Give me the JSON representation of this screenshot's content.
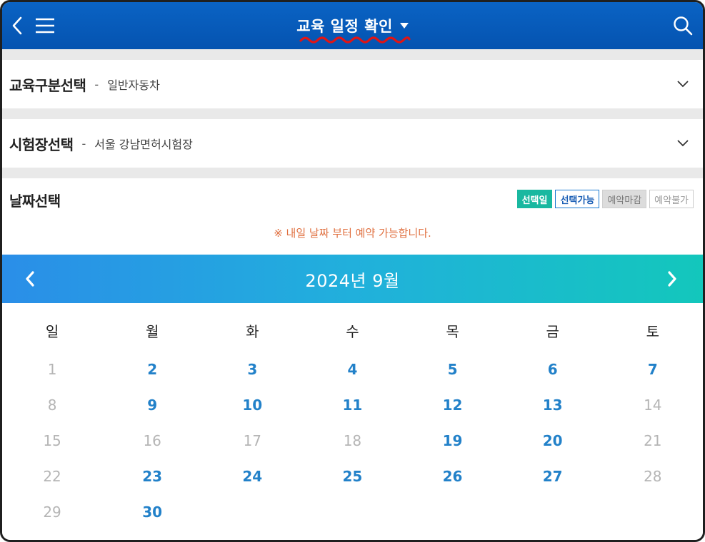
{
  "header": {
    "title": "교육 일정 확인",
    "bg_color": "#0553b0",
    "icons": {
      "back": "chevron-left-icon",
      "menu": "hamburger-menu-icon",
      "search": "search-icon",
      "dropdown": "caret-down-icon"
    }
  },
  "selectors": {
    "education_type": {
      "label": "교육구분선택",
      "separator": "-",
      "value": "일반자동차"
    },
    "test_center": {
      "label": "시험장선택",
      "separator": "-",
      "value": "서울 강남면허시험장"
    }
  },
  "date_panel": {
    "title": "날짜선택",
    "legend": {
      "selected": "선택일",
      "available": "선택가능",
      "closed": "예약마감",
      "unavailable": "예약불가"
    },
    "notice": "※ 내일 날짜 부터 예약 가능합니다.",
    "colors": {
      "selected": "#19b8a0",
      "available": "#2281c9",
      "unavailable": "#b5b5b5",
      "notice": "#e07040"
    }
  },
  "calendar": {
    "month_label": "2024년  9월",
    "weekdays": [
      "일",
      "월",
      "화",
      "수",
      "목",
      "금",
      "토"
    ],
    "weeks": [
      [
        {
          "d": "1",
          "av": false
        },
        {
          "d": "2",
          "av": true
        },
        {
          "d": "3",
          "av": true
        },
        {
          "d": "4",
          "av": true
        },
        {
          "d": "5",
          "av": true
        },
        {
          "d": "6",
          "av": true
        },
        {
          "d": "7",
          "av": true
        }
      ],
      [
        {
          "d": "8",
          "av": false
        },
        {
          "d": "9",
          "av": true
        },
        {
          "d": "10",
          "av": true
        },
        {
          "d": "11",
          "av": true
        },
        {
          "d": "12",
          "av": true
        },
        {
          "d": "13",
          "av": true
        },
        {
          "d": "14",
          "av": false
        }
      ],
      [
        {
          "d": "15",
          "av": false
        },
        {
          "d": "16",
          "av": false
        },
        {
          "d": "17",
          "av": false
        },
        {
          "d": "18",
          "av": false
        },
        {
          "d": "19",
          "av": true
        },
        {
          "d": "20",
          "av": true
        },
        {
          "d": "21",
          "av": false
        }
      ],
      [
        {
          "d": "22",
          "av": false
        },
        {
          "d": "23",
          "av": true
        },
        {
          "d": "24",
          "av": true
        },
        {
          "d": "25",
          "av": true
        },
        {
          "d": "26",
          "av": true
        },
        {
          "d": "27",
          "av": true
        },
        {
          "d": "28",
          "av": false
        }
      ],
      [
        {
          "d": "29",
          "av": false
        },
        {
          "d": "30",
          "av": true
        },
        {
          "d": "",
          "av": false
        },
        {
          "d": "",
          "av": false
        },
        {
          "d": "",
          "av": false
        },
        {
          "d": "",
          "av": false
        },
        {
          "d": "",
          "av": false
        }
      ]
    ]
  }
}
